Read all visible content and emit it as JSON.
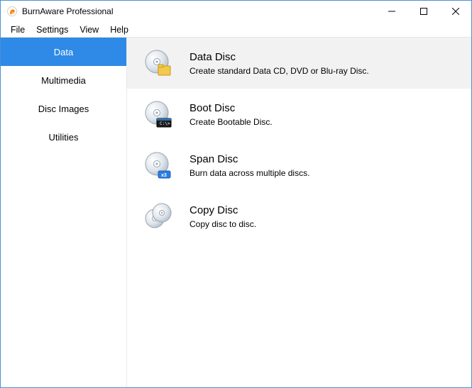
{
  "window": {
    "title": "BurnAware Professional"
  },
  "menu": {
    "file": "File",
    "settings": "Settings",
    "view": "View",
    "help": "Help"
  },
  "sidebar": {
    "items": [
      {
        "label": "Data",
        "active": true
      },
      {
        "label": "Multimedia",
        "active": false
      },
      {
        "label": "Disc Images",
        "active": false
      },
      {
        "label": "Utilities",
        "active": false
      }
    ]
  },
  "content": {
    "items": [
      {
        "title": "Data Disc",
        "desc": "Create standard Data CD, DVD or Blu-ray Disc.",
        "icon": "data-disc-icon",
        "selected": true
      },
      {
        "title": "Boot Disc",
        "desc": "Create Bootable Disc.",
        "icon": "boot-disc-icon",
        "selected": false
      },
      {
        "title": "Span Disc",
        "desc": "Burn data across multiple discs.",
        "icon": "span-disc-icon",
        "selected": false
      },
      {
        "title": "Copy Disc",
        "desc": "Copy disc to disc.",
        "icon": "copy-disc-icon",
        "selected": false
      }
    ]
  }
}
